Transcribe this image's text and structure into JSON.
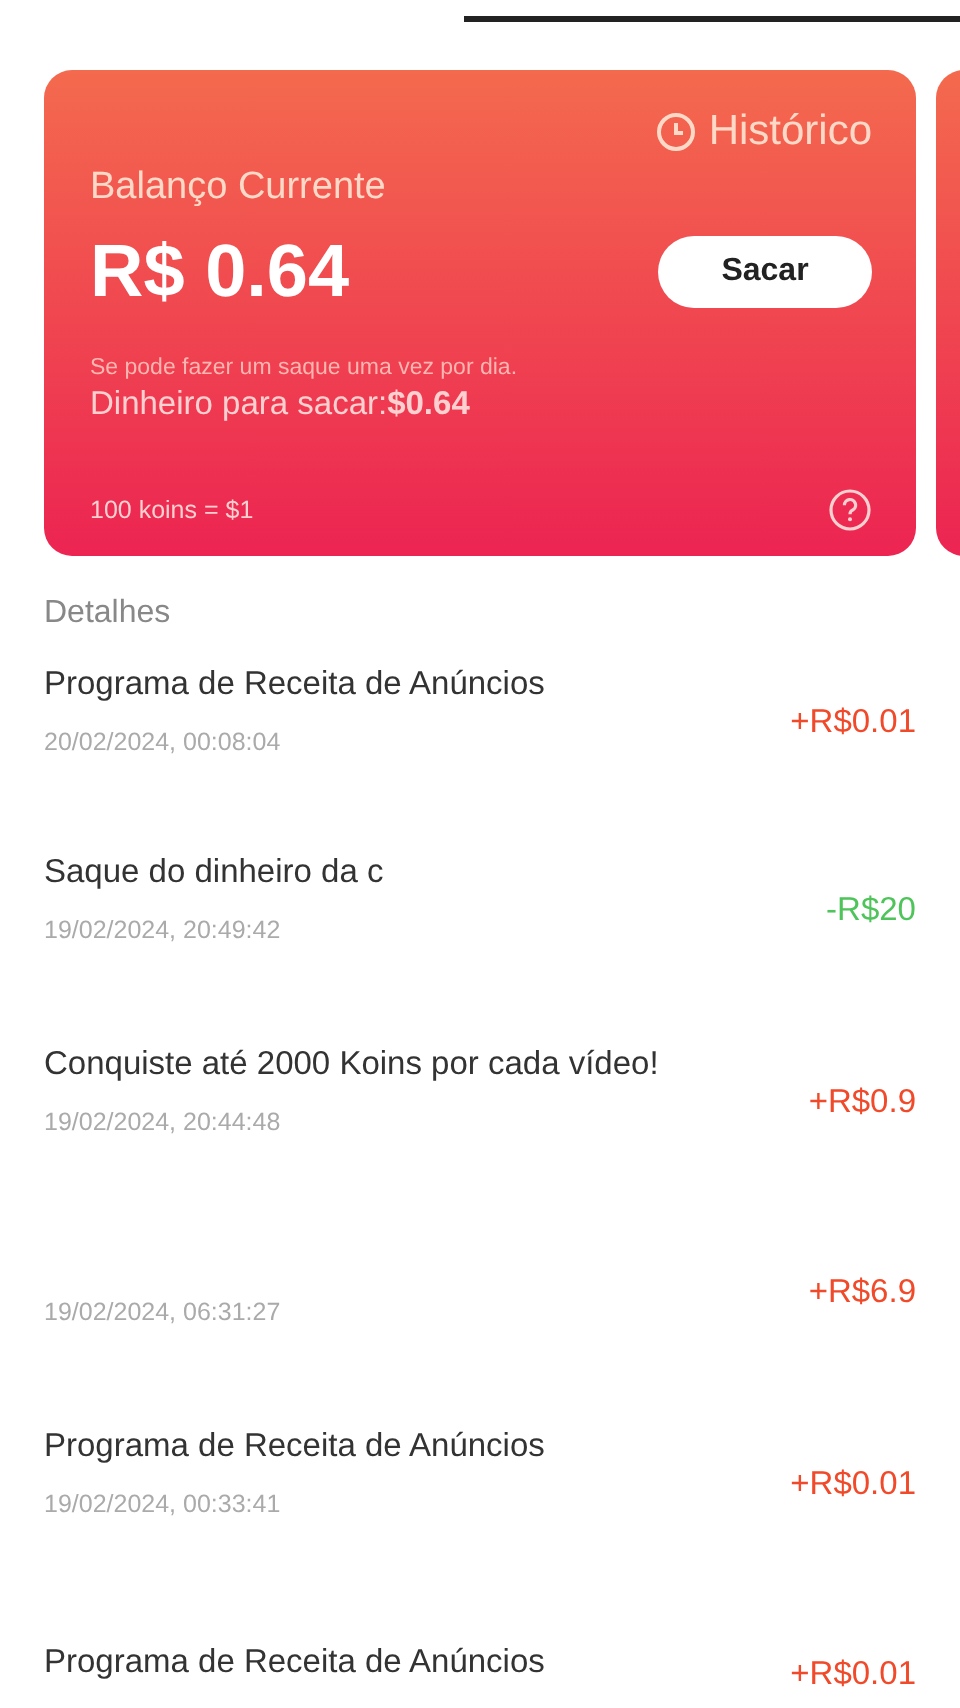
{
  "balance_card": {
    "history_link": "Histórico",
    "label": "Balanço Currente",
    "amount": "R$ 0.64",
    "withdraw_button": "Sacar",
    "note": "Se pode fazer um saque uma vez por dia.",
    "available": "Dinheiro para sacar:**$0.64**",
    "rate": "100 koins = $1"
  },
  "details_title": "Detalhes",
  "transactions": [
    {
      "title": "Programa de Receita de Anúncios",
      "date": "20/02/2024, 00:08:04",
      "amount": "+R$0.01",
      "kind": "credit"
    },
    {
      "title": "Saque do dinheiro da c",
      "date": "19/02/2024, 20:49:42",
      "amount": "-R$20",
      "kind": "debit"
    },
    {
      "title": "Conquiste até 2000 Koins por cada vídeo!",
      "date": "19/02/2024, 20:44:48",
      "amount": "+R$0.9",
      "kind": "credit"
    },
    {
      "date": "19/02/2024, 06:31:27",
      "amount": "+R$6.9",
      "kind": "credit"
    },
    {
      "title": "Programa de Receita de Anúncios",
      "date": "19/02/2024, 00:33:41",
      "amount": "+R$0.01",
      "kind": "credit"
    },
    {
      "title": "Programa de Receita de Anúncios",
      "amount": "+R$0.01",
      "kind": "credit"
    }
  ]
}
